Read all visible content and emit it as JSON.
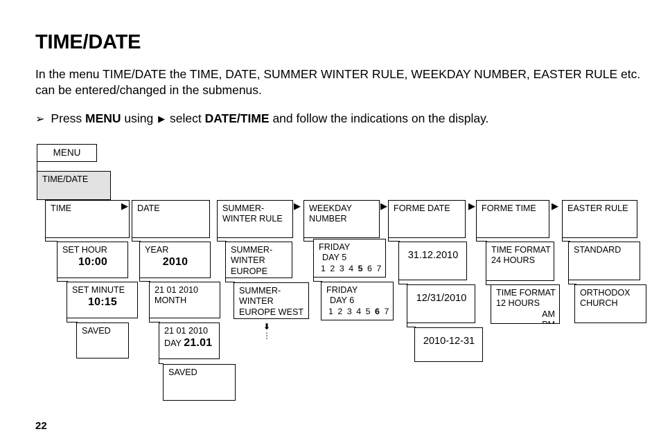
{
  "page": {
    "title": "TIME/DATE",
    "intro": "In the menu TIME/DATE the TIME, DATE, SUMMER WINTER RULE, WEEKDAY NUMBER, EASTER RULE etc. can be entered/changed in the submenus.",
    "number": "22"
  },
  "instruction": {
    "bullet": "➢",
    "part1": "Press ",
    "bold1": "MENU",
    "part2": " using ",
    "triangle": "▶",
    "part3": " select ",
    "bold2": "DATE/TIME",
    "part4": " and follow the indications on the display."
  },
  "menu_button": {
    "label": "MENU"
  },
  "arrow_glyph": "▶",
  "more_indicator": {
    "down": "⬇",
    "dots": "⋮"
  },
  "diagram": {
    "root": {
      "label": "TIME/DATE"
    },
    "columns": [
      {
        "id": "time",
        "header": {
          "line1": "TIME"
        },
        "steps": [
          {
            "id": "set-hour",
            "line1": "SET HOUR",
            "value": "10:00"
          },
          {
            "id": "set-minute",
            "line1": "SET MINUTE",
            "value": "10:15"
          },
          {
            "id": "saved",
            "line1": "SAVED"
          }
        ]
      },
      {
        "id": "date",
        "header": {
          "line1": "DATE"
        },
        "steps": [
          {
            "id": "year",
            "line1": "YEAR",
            "value": "2010"
          },
          {
            "id": "month",
            "line1": "21  01  2010",
            "line2": "MONTH"
          },
          {
            "id": "day",
            "line1": "21  01  2010",
            "prefix": "DAY ",
            "value": "21.01"
          },
          {
            "id": "saved",
            "line1": "SAVED"
          }
        ]
      },
      {
        "id": "summer-winter-rule",
        "header": {
          "line1": "SUMMER-",
          "line2": "WINTER RULE"
        },
        "steps": [
          {
            "id": "europe",
            "line1": "SUMMER-",
            "line2": "WINTER",
            "line3": "EUROPE"
          },
          {
            "id": "europe-west",
            "line1": "SUMMER-",
            "line2": "WINTER",
            "line3": "EUROPE WEST"
          }
        ]
      },
      {
        "id": "weekday-number",
        "header": {
          "line1": "WEEKDAY",
          "line2": "NUMBER"
        },
        "steps": [
          {
            "id": "friday-day5",
            "line1": "FRIDAY",
            "line2": "DAY 5",
            "days": [
              "1",
              "2",
              "3",
              "4",
              "5",
              "6",
              "7"
            ],
            "selected": "5"
          },
          {
            "id": "friday-day6",
            "line1": "FRIDAY",
            "line2": "DAY 6",
            "days": [
              "1",
              "2",
              "3",
              "4",
              "5",
              "6",
              "7"
            ],
            "selected": "6"
          }
        ]
      },
      {
        "id": "forme-date",
        "header": {
          "line1": "FORME DATE"
        },
        "steps": [
          {
            "id": "fmt-dot",
            "value": "31.12.2010"
          },
          {
            "id": "fmt-slash",
            "value": "12/31/2010"
          },
          {
            "id": "fmt-iso",
            "value": "2010-12-31"
          }
        ]
      },
      {
        "id": "forme-time",
        "header": {
          "line1": "FORME TIME"
        },
        "steps": [
          {
            "id": "t24",
            "line1": "TIME FORMAT",
            "line2": "24 HOURS"
          },
          {
            "id": "t12",
            "line1": "TIME FORMAT",
            "line2": "12 HOURS",
            "right1": "AM",
            "right2": "PM"
          }
        ]
      },
      {
        "id": "easter-rule",
        "header": {
          "line1": "EASTER RULE"
        },
        "steps": [
          {
            "id": "standard",
            "line1": "STANDARD"
          },
          {
            "id": "orthodox",
            "line1": "ORTHODOX",
            "line2": "CHURCH"
          }
        ]
      }
    ]
  }
}
